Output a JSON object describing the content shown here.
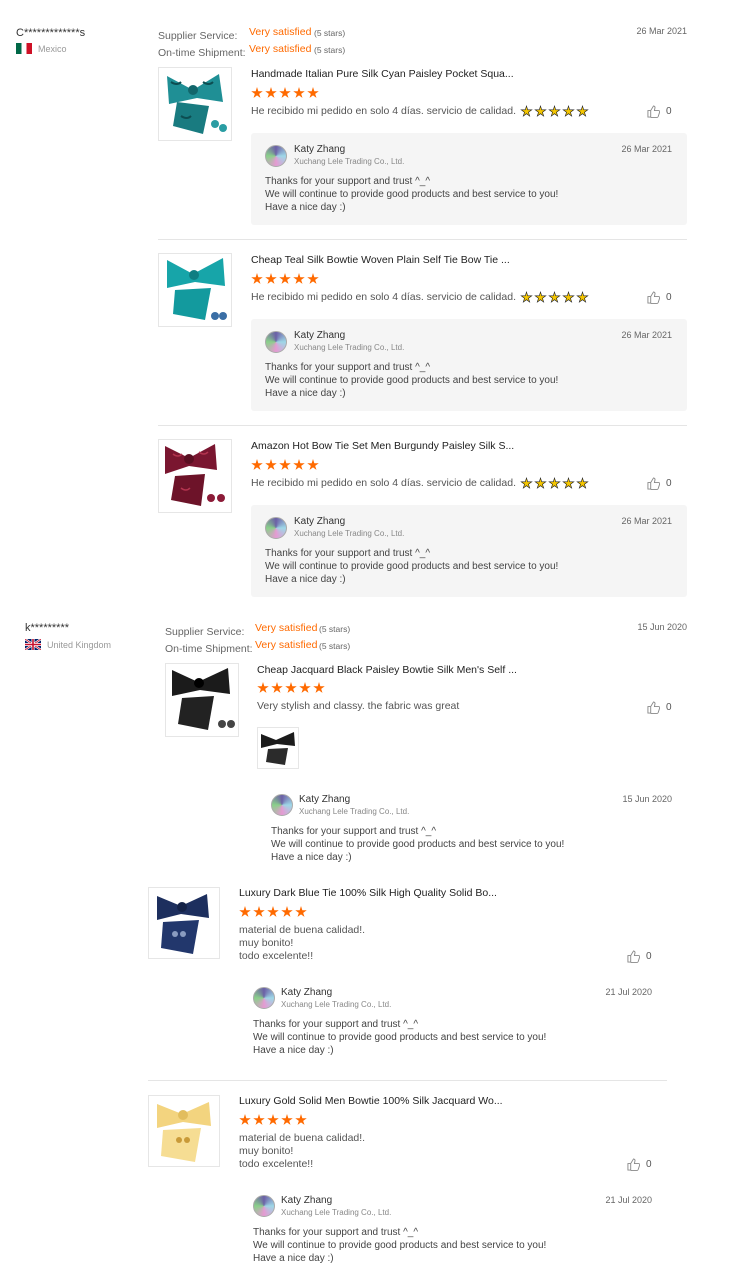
{
  "buyers": [
    {
      "name": "C*************s",
      "country": "Mexico",
      "flag_colors": [
        "#006847",
        "#ffffff",
        "#ce1126"
      ],
      "supplier_label": "Supplier Service:",
      "supplier_value": "Very satisfied",
      "supplier_stars": "(5 stars)",
      "shipment_label": "On-time Shipment:",
      "shipment_value": "Very satisfied",
      "shipment_stars": "(5 stars)",
      "date": "26 Mar 2021",
      "reviews": [
        {
          "title": "Handmade Italian Pure Silk Cyan Paisley Pocket Squa...",
          "rating": 5,
          "text": "He recibido mi pedido en solo 4 días. servicio de calidad.",
          "likes": "0",
          "reply": {
            "seller": "Katy Zhang",
            "company": "Xuchang Lele Trading Co., Ltd.",
            "date": "26 Mar 2021",
            "line1": "Thanks for your support and trust ^_^",
            "line2": "We will continue to provide good products and best service to you!",
            "line3": "Have a nice day :)"
          }
        },
        {
          "title": "Cheap Teal Silk Bowtie Woven Plain Self Tie Bow Tie ...",
          "rating": 5,
          "text": "He recibido mi pedido en solo 4 días. servicio de calidad.",
          "likes": "0",
          "reply": {
            "seller": "Katy Zhang",
            "company": "Xuchang Lele Trading Co., Ltd.",
            "date": "26 Mar 2021",
            "line1": "Thanks for your support and trust ^_^",
            "line2": "We will continue to provide good products and best service to you!",
            "line3": "Have a nice day :)"
          }
        },
        {
          "title": "Amazon Hot Bow Tie Set Men Burgundy Paisley Silk S...",
          "rating": 5,
          "text": "He recibido mi pedido en solo 4 días. servicio de calidad.",
          "likes": "0",
          "reply": {
            "seller": "Katy Zhang",
            "company": "Xuchang Lele Trading Co., Ltd.",
            "date": "26 Mar 2021",
            "line1": "Thanks for your support and trust ^_^",
            "line2": "We will continue to provide good products and best service to you!",
            "line3": "Have a nice day :)"
          }
        }
      ]
    },
    {
      "name": "k*********",
      "country": "United Kingdom",
      "supplier_label": "Supplier Service:",
      "supplier_value": "Very satisfied",
      "supplier_stars": "(5 stars)",
      "shipment_label": "On-time Shipment:",
      "shipment_value": "Very satisfied",
      "shipment_stars": "(5 stars)",
      "date": "15 Jun 2020",
      "reviews": [
        {
          "title": "Cheap Jacquard Black Paisley Bowtie Silk Men's Self ...",
          "rating": 5,
          "text": "Very stylish and classy. the fabric was great",
          "likes": "0",
          "reply": {
            "seller": "Katy Zhang",
            "company": "Xuchang Lele Trading Co., Ltd.",
            "date": "15 Jun 2020",
            "line1": "Thanks for your support and trust ^_^",
            "line2": "We will continue to provide good products and best service to you!",
            "line3": "Have a nice day :)"
          }
        },
        {
          "title": "Luxury Dark Blue Tie 100% Silk High Quality Solid Bo...",
          "rating": 5,
          "text_lines": [
            "material de buena calidad!.",
            "muy bonito!",
            "todo excelente!!"
          ],
          "likes": "0",
          "reply": {
            "seller": "Katy Zhang",
            "company": "Xuchang Lele Trading Co., Ltd.",
            "date": "21 Jul 2020",
            "line1": "Thanks for your support and trust ^_^",
            "line2": "We will continue to provide good products and best service to you!",
            "line3": "Have a nice day :)"
          }
        },
        {
          "title": "Luxury Gold Solid Men Bowtie 100% Silk Jacquard Wo...",
          "rating": 5,
          "text_lines": [
            "material de buena calidad!.",
            "muy bonito!",
            "todo excelente!!"
          ],
          "likes": "0",
          "reply": {
            "seller": "Katy Zhang",
            "company": "Xuchang Lele Trading Co., Ltd.",
            "date": "21 Jul 2020",
            "line1": "Thanks for your support and trust ^_^",
            "line2": "We will continue to provide good products and best service to you!",
            "line3": "Have a nice day :)"
          }
        }
      ]
    }
  ],
  "colors": {
    "accent": "#ff6a00",
    "product_cyan": "#1f8f95",
    "product_teal": "#17a5a9",
    "product_burgundy": "#7a1630",
    "product_black": "#1b1b1b",
    "product_navy": "#1d2f5e",
    "product_gold": "#f3d47f"
  }
}
